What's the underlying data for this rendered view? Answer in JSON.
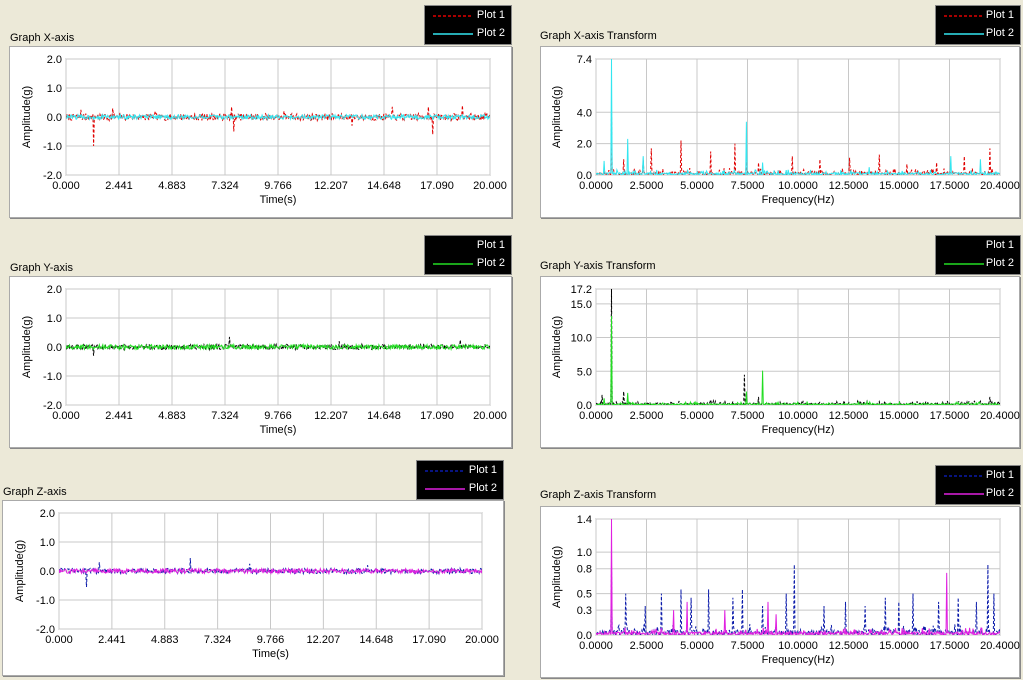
{
  "colors": {
    "background": "#ECE9D8",
    "red": "#E00000",
    "cyan": "#33E6F0",
    "green": "#22DD22",
    "black": "#000000",
    "blue": "#0A1AAA",
    "magenta": "#E020E0"
  },
  "chart_data": [
    {
      "id": "x-time",
      "type": "line",
      "title": "Graph X-axis",
      "xlabel": "Time(s)",
      "ylabel": "Amplitude(g)",
      "xlim": [
        0,
        20
      ],
      "ylim": [
        -2,
        2
      ],
      "xticks": [
        "0.000",
        "2.441",
        "4.883",
        "7.324",
        "9.766",
        "12.207",
        "14.648",
        "17.090",
        "20.000"
      ],
      "yticks": [
        "2.0",
        "1.0",
        "0.0",
        "-1.0",
        "-2.0"
      ],
      "legend": [
        "Plot 1",
        "Plot 2"
      ],
      "series": [
        {
          "name": "Plot 1",
          "color": "#E00000",
          "style": "dashed",
          "noise": 0.12,
          "spikes": [
            [
              1.3,
              -1.0
            ],
            [
              0.7,
              0.25
            ],
            [
              2.2,
              0.3
            ],
            [
              4.2,
              0.2
            ],
            [
              7.8,
              0.35
            ],
            [
              7.9,
              -0.5
            ],
            [
              10.3,
              0.2
            ],
            [
              13.5,
              -0.3
            ],
            [
              15.4,
              0.35
            ],
            [
              17.3,
              -0.6
            ],
            [
              17.1,
              0.35
            ],
            [
              18.7,
              0.4
            ]
          ]
        },
        {
          "name": "Plot 2",
          "color": "#33E6F0",
          "style": "solid",
          "noise": 0.08,
          "spikes": []
        }
      ]
    },
    {
      "id": "x-freq",
      "type": "line",
      "title": "Graph X-axis Transform",
      "xlabel": "Frequency(Hz)",
      "ylabel": "Amplitude(g)",
      "xlim": [
        0,
        20.4
      ],
      "ylim": [
        0,
        7.4
      ],
      "xticks": [
        "0.0000",
        "2.5000",
        "5.0000",
        "7.5000",
        "10.0000",
        "12.5000",
        "15.0000",
        "17.5000",
        "20.4000"
      ],
      "yticks": [
        "7.4",
        "4.0",
        "2.0",
        "0.0"
      ],
      "legend": [
        "Plot 1",
        "Plot 2"
      ],
      "series": [
        {
          "name": "Plot 1",
          "color": "#E00000",
          "style": "dashed",
          "noise": 0.2,
          "spikes": [
            [
              0.8,
              4.2
            ],
            [
              1.4,
              1.0
            ],
            [
              2.4,
              1.0
            ],
            [
              2.8,
              1.7
            ],
            [
              4.3,
              2.2
            ],
            [
              5.8,
              1.5
            ],
            [
              7.0,
              2.0
            ],
            [
              7.6,
              1.2
            ],
            [
              8.2,
              0.8
            ],
            [
              9.9,
              1.2
            ],
            [
              11.3,
              1.0
            ],
            [
              12.8,
              1.1
            ],
            [
              14.3,
              1.3
            ],
            [
              15.7,
              0.7
            ],
            [
              17.2,
              0.8
            ],
            [
              18.6,
              1.2
            ],
            [
              19.9,
              1.7
            ]
          ]
        },
        {
          "name": "Plot 2",
          "color": "#33E6F0",
          "style": "solid",
          "noise": 0.15,
          "spikes": [
            [
              0.8,
              7.4
            ],
            [
              0.4,
              0.9
            ],
            [
              1.6,
              2.3
            ],
            [
              2.4,
              1.2
            ],
            [
              7.6,
              3.4
            ],
            [
              8.4,
              0.8
            ],
            [
              13.8,
              0.5
            ],
            [
              17.9,
              1.2
            ],
            [
              19.4,
              1.0
            ]
          ]
        }
      ]
    },
    {
      "id": "y-time",
      "type": "line",
      "title": "Graph Y-axis",
      "xlabel": "Time(s)",
      "ylabel": "Amplitude(g)",
      "xlim": [
        0,
        20
      ],
      "ylim": [
        -2,
        2
      ],
      "xticks": [
        "0.000",
        "2.441",
        "4.883",
        "7.324",
        "9.766",
        "12.207",
        "14.648",
        "17.090",
        "20.000"
      ],
      "yticks": [
        "2.0",
        "1.0",
        "0.0",
        "-1.0",
        "-2.0"
      ],
      "legend": [
        "Plot 1",
        "Plot 2"
      ],
      "series": [
        {
          "name": "Plot 1",
          "color": "#000000",
          "style": "dashed",
          "noise": 0.09,
          "spikes": [
            [
              1.3,
              -0.3
            ],
            [
              7.7,
              0.35
            ],
            [
              12.9,
              0.2
            ],
            [
              18.6,
              0.25
            ]
          ]
        },
        {
          "name": "Plot 2",
          "color": "#22DD22",
          "style": "solid",
          "noise": 0.08,
          "spikes": []
        }
      ]
    },
    {
      "id": "y-freq",
      "type": "line",
      "title": "Graph Y-axis Transform",
      "xlabel": "Frequency(Hz)",
      "ylabel": "Amplitude(g)",
      "xlim": [
        0,
        20.4
      ],
      "ylim": [
        0,
        17.2
      ],
      "xticks": [
        "0.0000",
        "2.5000",
        "5.0000",
        "7.5000",
        "10.0000",
        "12.5000",
        "15.0000",
        "17.5000",
        "20.4000"
      ],
      "yticks": [
        "17.2",
        "15.0",
        "10.0",
        "5.0",
        "0.0"
      ],
      "legend": [
        "Plot 1",
        "Plot 2"
      ],
      "series": [
        {
          "name": "Plot 1",
          "color": "#000000",
          "style": "dashed",
          "noise": 0.3,
          "spikes": [
            [
              0.8,
              17.2
            ],
            [
              0.3,
              1.5
            ],
            [
              1.4,
              2.0
            ],
            [
              4.2,
              0.6
            ],
            [
              5.8,
              0.8
            ],
            [
              7.5,
              4.5
            ],
            [
              8.2,
              1.2
            ],
            [
              11.3,
              0.4
            ],
            [
              14.3,
              0.5
            ],
            [
              17.5,
              0.4
            ],
            [
              19.9,
              1.2
            ]
          ]
        },
        {
          "name": "Plot 2",
          "color": "#22DD22",
          "style": "solid",
          "noise": 0.2,
          "spikes": [
            [
              0.8,
              13.2
            ],
            [
              1.6,
              1.8
            ],
            [
              7.6,
              2.0
            ],
            [
              8.4,
              5.1
            ],
            [
              0.4,
              1.0
            ]
          ]
        }
      ]
    },
    {
      "id": "z-time",
      "type": "line",
      "title": "Graph Z-axis",
      "xlabel": "Time(s)",
      "ylabel": "Amplitude(g)",
      "xlim": [
        0,
        20
      ],
      "ylim": [
        -2,
        2
      ],
      "xticks": [
        "0.000",
        "2.441",
        "4.883",
        "7.324",
        "9.766",
        "12.207",
        "14.648",
        "17.090",
        "20.000"
      ],
      "yticks": [
        "2.0",
        "1.0",
        "0.0",
        "-1.0",
        "-2.0"
      ],
      "legend": [
        "Plot 1",
        "Plot 2"
      ],
      "series": [
        {
          "name": "Plot 1",
          "color": "#0A1AAA",
          "style": "dashed",
          "noise": 0.09,
          "spikes": [
            [
              1.3,
              -0.55
            ],
            [
              1.9,
              0.3
            ],
            [
              6.2,
              0.45
            ],
            [
              9.0,
              0.25
            ],
            [
              14.6,
              0.2
            ]
          ]
        },
        {
          "name": "Plot 2",
          "color": "#E020E0",
          "style": "solid",
          "noise": 0.08,
          "spikes": []
        }
      ]
    },
    {
      "id": "z-freq",
      "type": "line",
      "title": "Graph Z-axis Transform",
      "xlabel": "Frequency(Hz)",
      "ylabel": "Amplitude(g)",
      "xlim": [
        0,
        20.4
      ],
      "ylim": [
        0,
        1.4
      ],
      "xticks": [
        "0.0000",
        "2.5000",
        "5.0000",
        "7.5000",
        "10.0000",
        "12.5000",
        "15.0000",
        "17.5000",
        "20.4000"
      ],
      "yticks": [
        "1.4",
        "1.0",
        "0.8",
        "0.5",
        "0.3",
        "0.0"
      ],
      "legend": [
        "Plot 1",
        "Plot 2"
      ],
      "series": [
        {
          "name": "Plot 1",
          "color": "#0A1AAA",
          "style": "dashed",
          "noise": 0.06,
          "spikes": [
            [
              0.8,
              0.85
            ],
            [
              1.5,
              0.5
            ],
            [
              2.5,
              0.35
            ],
            [
              3.3,
              0.5
            ],
            [
              4.3,
              0.55
            ],
            [
              4.8,
              0.45
            ],
            [
              5.7,
              0.55
            ],
            [
              6.9,
              0.45
            ],
            [
              7.4,
              0.55
            ],
            [
              8.4,
              0.35
            ],
            [
              9.6,
              0.5
            ],
            [
              10.0,
              0.85
            ],
            [
              11.5,
              0.35
            ],
            [
              12.6,
              0.4
            ],
            [
              13.6,
              0.35
            ],
            [
              14.6,
              0.45
            ],
            [
              15.3,
              0.4
            ],
            [
              16.0,
              0.5
            ],
            [
              17.3,
              0.4
            ],
            [
              18.3,
              0.45
            ],
            [
              19.2,
              0.4
            ],
            [
              19.8,
              0.85
            ],
            [
              20.1,
              0.5
            ]
          ]
        },
        {
          "name": "Plot 2",
          "color": "#E020E0",
          "style": "solid",
          "noise": 0.04,
          "spikes": [
            [
              0.8,
              1.4
            ],
            [
              3.9,
              0.3
            ],
            [
              4.6,
              0.4
            ],
            [
              6.5,
              0.3
            ],
            [
              8.7,
              0.4
            ],
            [
              9.1,
              0.25
            ],
            [
              17.7,
              0.75
            ]
          ]
        }
      ]
    }
  ]
}
